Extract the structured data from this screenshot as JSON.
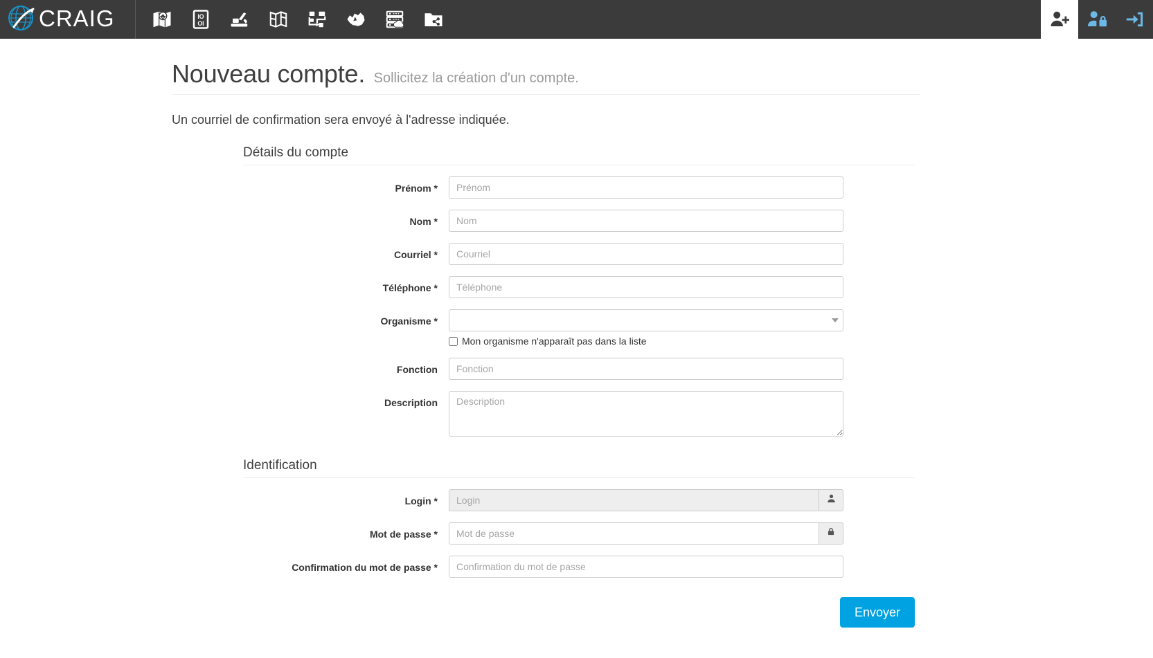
{
  "navbar": {
    "brand_text": "CRAIG",
    "left_icons": [
      {
        "name": "map-pin-icon",
        "title": "Cartes"
      },
      {
        "name": "data-binary-icon",
        "title": "Données"
      },
      {
        "name": "excavator-icon",
        "title": "Chantiers"
      },
      {
        "name": "folded-map-icon",
        "title": "Atlas"
      },
      {
        "name": "workflow-icon",
        "title": "Traitements"
      },
      {
        "name": "territory-icon",
        "title": "Territoires"
      },
      {
        "name": "server-cloud-icon",
        "title": "Serveurs"
      },
      {
        "name": "folder-share-icon",
        "title": "Partage"
      }
    ],
    "right_icons": [
      {
        "name": "user-add-icon",
        "title": "Nouveau compte",
        "active": true
      },
      {
        "name": "user-lock-icon",
        "title": "Mot de passe oublié",
        "active": false
      },
      {
        "name": "login-arrow-icon",
        "title": "Connexion",
        "active": false
      }
    ]
  },
  "page": {
    "title": "Nouveau compte.",
    "subtitle": "Sollicitez la création d'un compte.",
    "intro": "Un courriel de confirmation sera envoyé à l'adresse indiquée."
  },
  "sections": {
    "account_details": {
      "legend": "Détails du compte",
      "fields": {
        "firstname": {
          "label": "Prénom *",
          "placeholder": "Prénom",
          "value": ""
        },
        "lastname": {
          "label": "Nom *",
          "placeholder": "Nom",
          "value": ""
        },
        "email": {
          "label": "Courriel *",
          "placeholder": "Courriel",
          "value": ""
        },
        "phone": {
          "label": "Téléphone *",
          "placeholder": "Téléphone",
          "value": ""
        },
        "organisation": {
          "label": "Organisme *",
          "selected": "",
          "options": [
            ""
          ]
        },
        "organisation_checkbox": "Mon organisme n'apparaît pas dans la liste",
        "function": {
          "label": "Fonction",
          "placeholder": "Fonction",
          "value": ""
        },
        "description": {
          "label": "Description",
          "placeholder": "Description",
          "value": ""
        }
      }
    },
    "identification": {
      "legend": "Identification",
      "fields": {
        "login": {
          "label": "Login *",
          "placeholder": "Login",
          "value": ""
        },
        "password": {
          "label": "Mot de passe *",
          "placeholder": "Mot de passe",
          "value": ""
        },
        "password_confirm": {
          "label": "Confirmation du mot de passe *",
          "placeholder": "Confirmation du mot de passe",
          "value": ""
        }
      }
    }
  },
  "actions": {
    "submit_label": "Envoyer"
  },
  "colors": {
    "navbar_bg": "#3b3b3b",
    "accent_blue": "#00a2e1",
    "icon_blue": "#6cb9e8",
    "text_dark": "#3f3f3f",
    "muted": "#9a9a9a"
  }
}
